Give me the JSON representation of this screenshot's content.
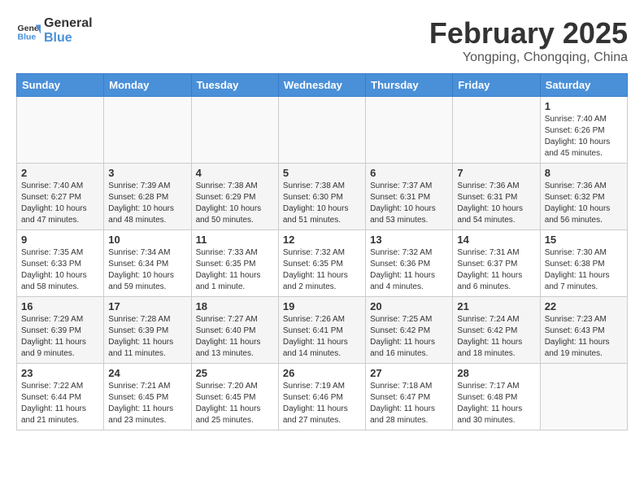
{
  "header": {
    "logo_general": "General",
    "logo_blue": "Blue",
    "month_year": "February 2025",
    "location": "Yongping, Chongqing, China"
  },
  "weekdays": [
    "Sunday",
    "Monday",
    "Tuesday",
    "Wednesday",
    "Thursday",
    "Friday",
    "Saturday"
  ],
  "weeks": [
    [
      {
        "day": "",
        "info": ""
      },
      {
        "day": "",
        "info": ""
      },
      {
        "day": "",
        "info": ""
      },
      {
        "day": "",
        "info": ""
      },
      {
        "day": "",
        "info": ""
      },
      {
        "day": "",
        "info": ""
      },
      {
        "day": "1",
        "info": "Sunrise: 7:40 AM\nSunset: 6:26 PM\nDaylight: 10 hours and 45 minutes."
      }
    ],
    [
      {
        "day": "2",
        "info": "Sunrise: 7:40 AM\nSunset: 6:27 PM\nDaylight: 10 hours and 47 minutes."
      },
      {
        "day": "3",
        "info": "Sunrise: 7:39 AM\nSunset: 6:28 PM\nDaylight: 10 hours and 48 minutes."
      },
      {
        "day": "4",
        "info": "Sunrise: 7:38 AM\nSunset: 6:29 PM\nDaylight: 10 hours and 50 minutes."
      },
      {
        "day": "5",
        "info": "Sunrise: 7:38 AM\nSunset: 6:30 PM\nDaylight: 10 hours and 51 minutes."
      },
      {
        "day": "6",
        "info": "Sunrise: 7:37 AM\nSunset: 6:31 PM\nDaylight: 10 hours and 53 minutes."
      },
      {
        "day": "7",
        "info": "Sunrise: 7:36 AM\nSunset: 6:31 PM\nDaylight: 10 hours and 54 minutes."
      },
      {
        "day": "8",
        "info": "Sunrise: 7:36 AM\nSunset: 6:32 PM\nDaylight: 10 hours and 56 minutes."
      }
    ],
    [
      {
        "day": "9",
        "info": "Sunrise: 7:35 AM\nSunset: 6:33 PM\nDaylight: 10 hours and 58 minutes."
      },
      {
        "day": "10",
        "info": "Sunrise: 7:34 AM\nSunset: 6:34 PM\nDaylight: 10 hours and 59 minutes."
      },
      {
        "day": "11",
        "info": "Sunrise: 7:33 AM\nSunset: 6:35 PM\nDaylight: 11 hours and 1 minute."
      },
      {
        "day": "12",
        "info": "Sunrise: 7:32 AM\nSunset: 6:35 PM\nDaylight: 11 hours and 2 minutes."
      },
      {
        "day": "13",
        "info": "Sunrise: 7:32 AM\nSunset: 6:36 PM\nDaylight: 11 hours and 4 minutes."
      },
      {
        "day": "14",
        "info": "Sunrise: 7:31 AM\nSunset: 6:37 PM\nDaylight: 11 hours and 6 minutes."
      },
      {
        "day": "15",
        "info": "Sunrise: 7:30 AM\nSunset: 6:38 PM\nDaylight: 11 hours and 7 minutes."
      }
    ],
    [
      {
        "day": "16",
        "info": "Sunrise: 7:29 AM\nSunset: 6:39 PM\nDaylight: 11 hours and 9 minutes."
      },
      {
        "day": "17",
        "info": "Sunrise: 7:28 AM\nSunset: 6:39 PM\nDaylight: 11 hours and 11 minutes."
      },
      {
        "day": "18",
        "info": "Sunrise: 7:27 AM\nSunset: 6:40 PM\nDaylight: 11 hours and 13 minutes."
      },
      {
        "day": "19",
        "info": "Sunrise: 7:26 AM\nSunset: 6:41 PM\nDaylight: 11 hours and 14 minutes."
      },
      {
        "day": "20",
        "info": "Sunrise: 7:25 AM\nSunset: 6:42 PM\nDaylight: 11 hours and 16 minutes."
      },
      {
        "day": "21",
        "info": "Sunrise: 7:24 AM\nSunset: 6:42 PM\nDaylight: 11 hours and 18 minutes."
      },
      {
        "day": "22",
        "info": "Sunrise: 7:23 AM\nSunset: 6:43 PM\nDaylight: 11 hours and 19 minutes."
      }
    ],
    [
      {
        "day": "23",
        "info": "Sunrise: 7:22 AM\nSunset: 6:44 PM\nDaylight: 11 hours and 21 minutes."
      },
      {
        "day": "24",
        "info": "Sunrise: 7:21 AM\nSunset: 6:45 PM\nDaylight: 11 hours and 23 minutes."
      },
      {
        "day": "25",
        "info": "Sunrise: 7:20 AM\nSunset: 6:45 PM\nDaylight: 11 hours and 25 minutes."
      },
      {
        "day": "26",
        "info": "Sunrise: 7:19 AM\nSunset: 6:46 PM\nDaylight: 11 hours and 27 minutes."
      },
      {
        "day": "27",
        "info": "Sunrise: 7:18 AM\nSunset: 6:47 PM\nDaylight: 11 hours and 28 minutes."
      },
      {
        "day": "28",
        "info": "Sunrise: 7:17 AM\nSunset: 6:48 PM\nDaylight: 11 hours and 30 minutes."
      },
      {
        "day": "",
        "info": ""
      }
    ]
  ]
}
